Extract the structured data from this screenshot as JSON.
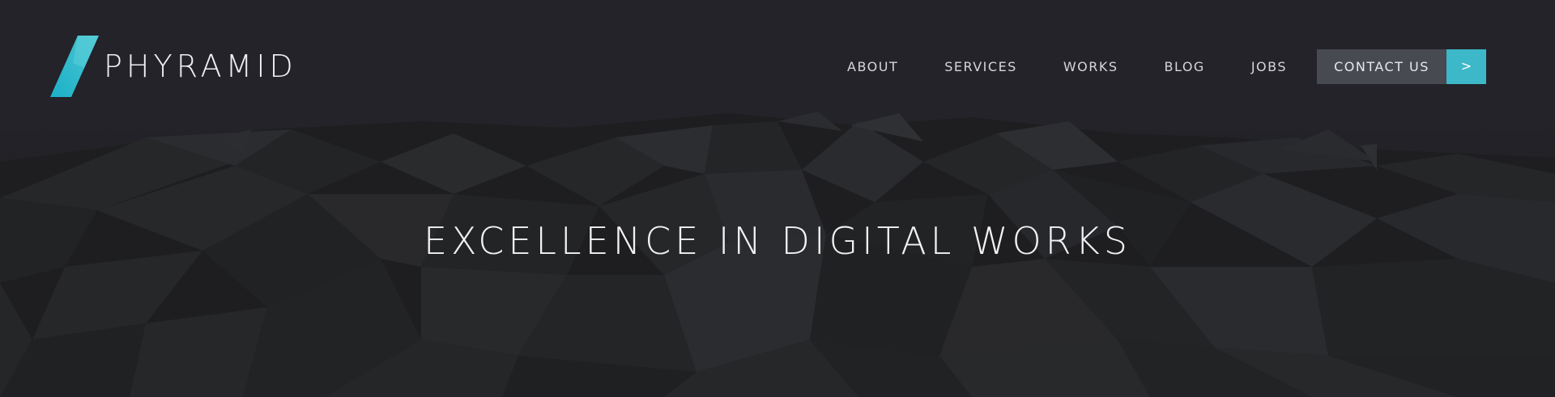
{
  "brand": {
    "name": "PHYRAMID",
    "accent_color": "#3cb8c8"
  },
  "nav": {
    "items": [
      {
        "label": "ABOUT"
      },
      {
        "label": "SERVICES"
      },
      {
        "label": "WORKS"
      },
      {
        "label": "BLOG"
      },
      {
        "label": "JOBS"
      }
    ],
    "contact": {
      "label": "CONTACT US",
      "arrow": ">"
    }
  },
  "hero": {
    "headline": "EXCELLENCE IN DIGITAL WORKS",
    "background_color": "#222228"
  }
}
